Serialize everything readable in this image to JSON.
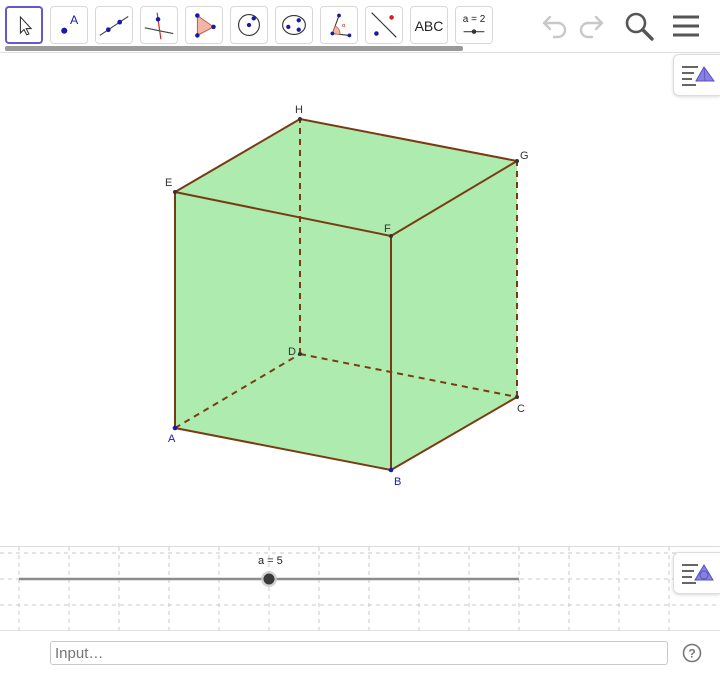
{
  "toolbar": {
    "tools": [
      {
        "name": "move"
      },
      {
        "name": "point",
        "label": "A"
      },
      {
        "name": "line"
      },
      {
        "name": "perpendicular-line"
      },
      {
        "name": "polygon"
      },
      {
        "name": "circle-center-point"
      },
      {
        "name": "conic"
      },
      {
        "name": "angle"
      },
      {
        "name": "reflect"
      },
      {
        "name": "text",
        "label": "ABC"
      },
      {
        "name": "slider",
        "label": "a = 2"
      }
    ],
    "right_icons": [
      "undo-icon",
      "redo-icon",
      "search-icon",
      "menu-icon"
    ]
  },
  "cube": {
    "face_color": "#99e699",
    "edge_color": "#7a3b14",
    "point_color": "#1a1aa8",
    "labels": {
      "A": "A",
      "B": "B",
      "C": "C",
      "D": "D",
      "E": "E",
      "F": "F",
      "G": "G",
      "H": "H"
    }
  },
  "slider": {
    "label": "a = 5",
    "value": 5
  },
  "input_bar": {
    "placeholder": "Input…"
  },
  "help_label": "?"
}
